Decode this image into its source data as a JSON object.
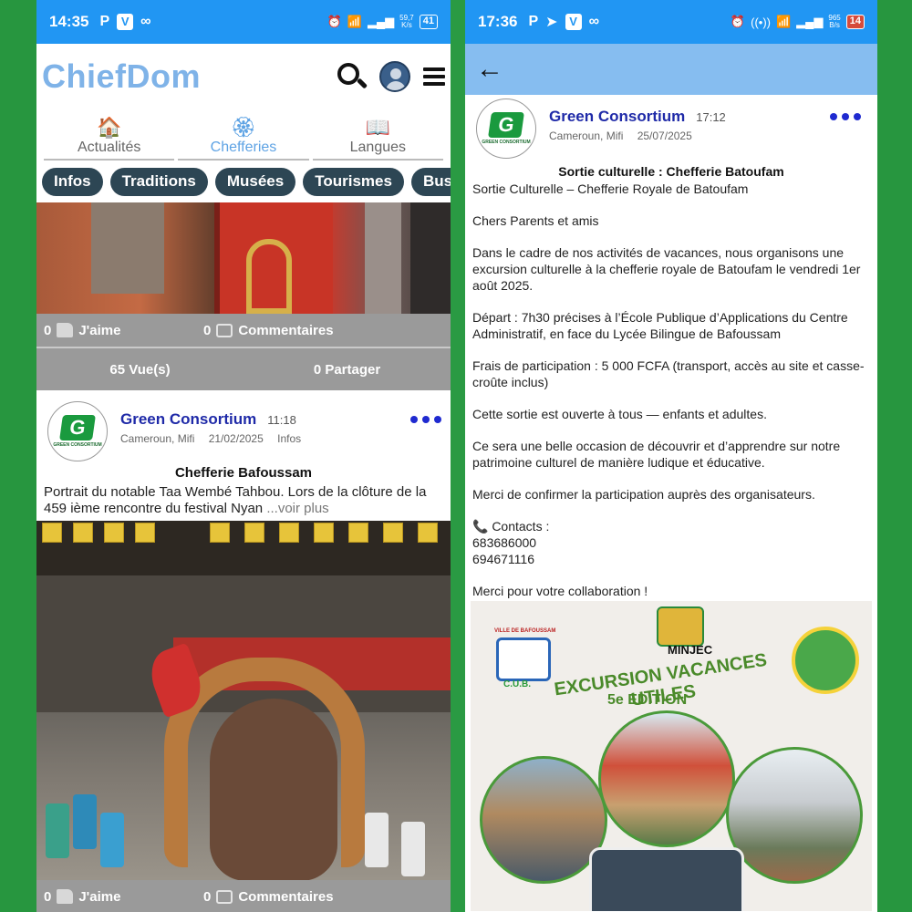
{
  "left": {
    "status": {
      "time": "14:35",
      "speed_top": "59,7",
      "speed_bottom": "K/s",
      "battery": "41"
    },
    "brand": "ChiefDom",
    "nav_tabs": [
      {
        "label": "Actualités",
        "icon": "house-icon",
        "active": false
      },
      {
        "label": "Chefferies",
        "icon": "chiefdom-emblem-icon",
        "active": true
      },
      {
        "label": "Langues",
        "icon": "book-icon",
        "active": false
      }
    ],
    "chips": [
      "Infos",
      "Traditions",
      "Musées",
      "Tourismes",
      "Busine"
    ],
    "post1_actions": {
      "like_count": "0",
      "like_label": "J'aime",
      "comment_count": "0",
      "comment_label": "Commentaires"
    },
    "post1_stats": {
      "views": "65 Vue(s)",
      "shares": "0 Partager"
    },
    "post2": {
      "author": "Green Consortium",
      "time": "11:18",
      "location": "Cameroun, Mifi",
      "date": "21/02/2025",
      "category": "Infos",
      "logo_text": "GREEN CONSORTIUM",
      "title": "Chefferie Bafoussam",
      "body": "Portrait du notable Taa Wembé Tahbou. Lors de la clôture de la 459 ième rencontre du festival Nyan ",
      "more": "...voir plus"
    },
    "post2_actions": {
      "like_count": "0",
      "like_label": "J'aime",
      "comment_count": "0",
      "comment_label": "Commentaires"
    }
  },
  "right": {
    "status": {
      "time": "17:36",
      "speed_top": "965",
      "speed_bottom": "B/s",
      "battery": "14"
    },
    "post": {
      "author": "Green Consortium",
      "time": "17:12",
      "location": "Cameroun, Mifi",
      "date": "25/07/2025",
      "logo_text": "GREEN CONSORTIUM",
      "title": "Sortie culturelle : Chefferie Batoufam",
      "paragraphs": [
        "Sortie Culturelle – Chefferie Royale de Batoufam",
        "Chers Parents et amis",
        "Dans le cadre de nos activités de vacances, nous organisons une excursion culturelle à la chefferie royale de Batoufam le vendredi 1er août 2025.",
        "Départ : 7h30 précises à l’École Publique d’Applications du Centre Administratif, en face du Lycée Bilingue de Bafoussam",
        "Frais de participation : 5 000 FCFA (transport, accès au site et casse-croûte inclus)",
        "Cette sortie est ouverte à tous — enfants et adultes.",
        "Ce sera une belle occasion de découvrir et d’apprendre sur notre patrimoine culturel de manière ludique et éducative.",
        "Merci de confirmer la participation auprès des organisateurs."
      ],
      "contacts_label": "📞 Contacts :",
      "phone1": "683686000",
      "phone2": "694671116",
      "closing": "Merci pour votre collaboration !"
    },
    "poster": {
      "ville": "VILLE DE BAFOUSSAM",
      "cub": "C.U.B.",
      "minjec": "MINJEC",
      "title": "EXCURSION VACANCES UTILES",
      "edition": "5e EDITION"
    }
  }
}
